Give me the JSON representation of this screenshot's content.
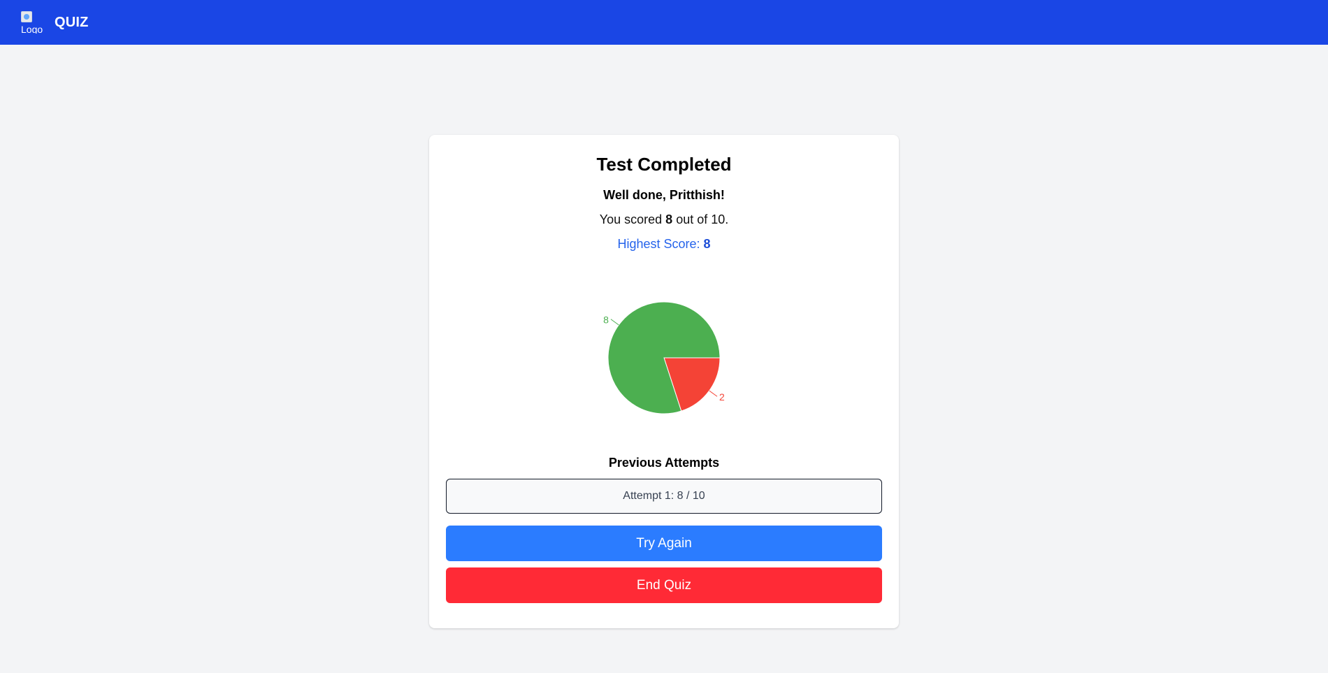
{
  "navbar": {
    "logo_alt": "Logo",
    "brand": "QUIZ",
    "background": "#1a46e5"
  },
  "result": {
    "title": "Test Completed",
    "greeting": "Well done, Pritthish!",
    "score_prefix": "You scored",
    "score": "8",
    "score_suffix": "out of 10.",
    "highest_label": "Highest Score:",
    "highest_value": "8"
  },
  "chart_data": {
    "type": "pie",
    "values": [
      8,
      2
    ],
    "labels": [
      "8",
      "2"
    ],
    "colors": [
      "#4caf50",
      "#f44336"
    ]
  },
  "attempts": {
    "heading": "Previous Attempts",
    "items": [
      {
        "label": "Attempt 1: 8 / 10"
      }
    ]
  },
  "actions": {
    "try_again": "Try Again",
    "end_quiz": "End Quiz",
    "try_again_color": "#2b7cff",
    "end_quiz_color": "#ff2a36"
  }
}
